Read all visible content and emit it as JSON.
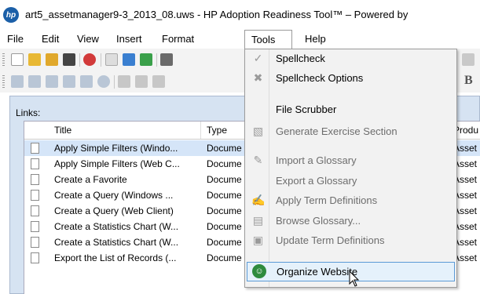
{
  "window": {
    "app_icon": "hp",
    "title": "art5_assetmanager9-3_2013_08.uws - HP Adoption Readiness Tool™ – Powered by"
  },
  "menubar": {
    "items": [
      {
        "label": "File"
      },
      {
        "label": "Edit"
      },
      {
        "label": "View"
      },
      {
        "label": "Insert"
      },
      {
        "label": "Format"
      },
      {
        "label": "Tools"
      },
      {
        "label": "Help"
      }
    ]
  },
  "tools_menu": {
    "items": [
      {
        "label": "Spellcheck",
        "icon": "spellcheck-icon",
        "enabled": true
      },
      {
        "label": "Spellcheck Options",
        "icon": "tools-icon",
        "enabled": true
      },
      {
        "label": "File Scrubber",
        "icon": "",
        "enabled": true
      },
      {
        "label": "Generate Exercise Section",
        "icon": "exercise-icon",
        "enabled": false
      },
      {
        "label": "Import a Glossary",
        "icon": "import-glossary-icon",
        "enabled": false
      },
      {
        "label": "Export a Glossary",
        "icon": "",
        "enabled": true
      },
      {
        "label": "Apply Term Definitions",
        "icon": "apply-terms-icon",
        "enabled": false
      },
      {
        "label": "Browse Glossary...",
        "icon": "browse-glossary-icon",
        "enabled": false
      },
      {
        "label": "Update Term Definitions",
        "icon": "update-terms-icon",
        "enabled": false
      },
      {
        "label": "Organize Website",
        "icon": "organize-website-icon",
        "enabled": true,
        "highlighted": true
      }
    ]
  },
  "links": {
    "label": "Links:",
    "columns": [
      "Title",
      "Type",
      "Produ"
    ],
    "rows": [
      {
        "title": "Apply Simple Filters (Windo...",
        "type": "Docume",
        "product": "Asset",
        "selected": true
      },
      {
        "title": "Apply Simple Filters (Web C...",
        "type": "Docume",
        "product": "Asset",
        "selected": false
      },
      {
        "title": "Create a Favorite",
        "type": "Docume",
        "product": "Asset",
        "selected": false
      },
      {
        "title": "Create a Query (Windows ...",
        "type": "Docume",
        "product": "Asset",
        "selected": false
      },
      {
        "title": "Create a Query (Web Client)",
        "type": "Docume",
        "product": "Asset",
        "selected": false
      },
      {
        "title": "Create a Statistics Chart (W...",
        "type": "Docume",
        "product": "Asset",
        "selected": false
      },
      {
        "title": "Create a Statistics Chart (W...",
        "type": "Docume",
        "product": "Asset",
        "selected": false
      },
      {
        "title": "Export the List of Records (...",
        "type": "Docume",
        "product": "Asset",
        "selected": false
      }
    ]
  },
  "toolbar_hint_letter": "B",
  "colors": {
    "accent": "#5b9ad6",
    "selection": "#d5e5f8",
    "frame": "#d6e3f2"
  }
}
